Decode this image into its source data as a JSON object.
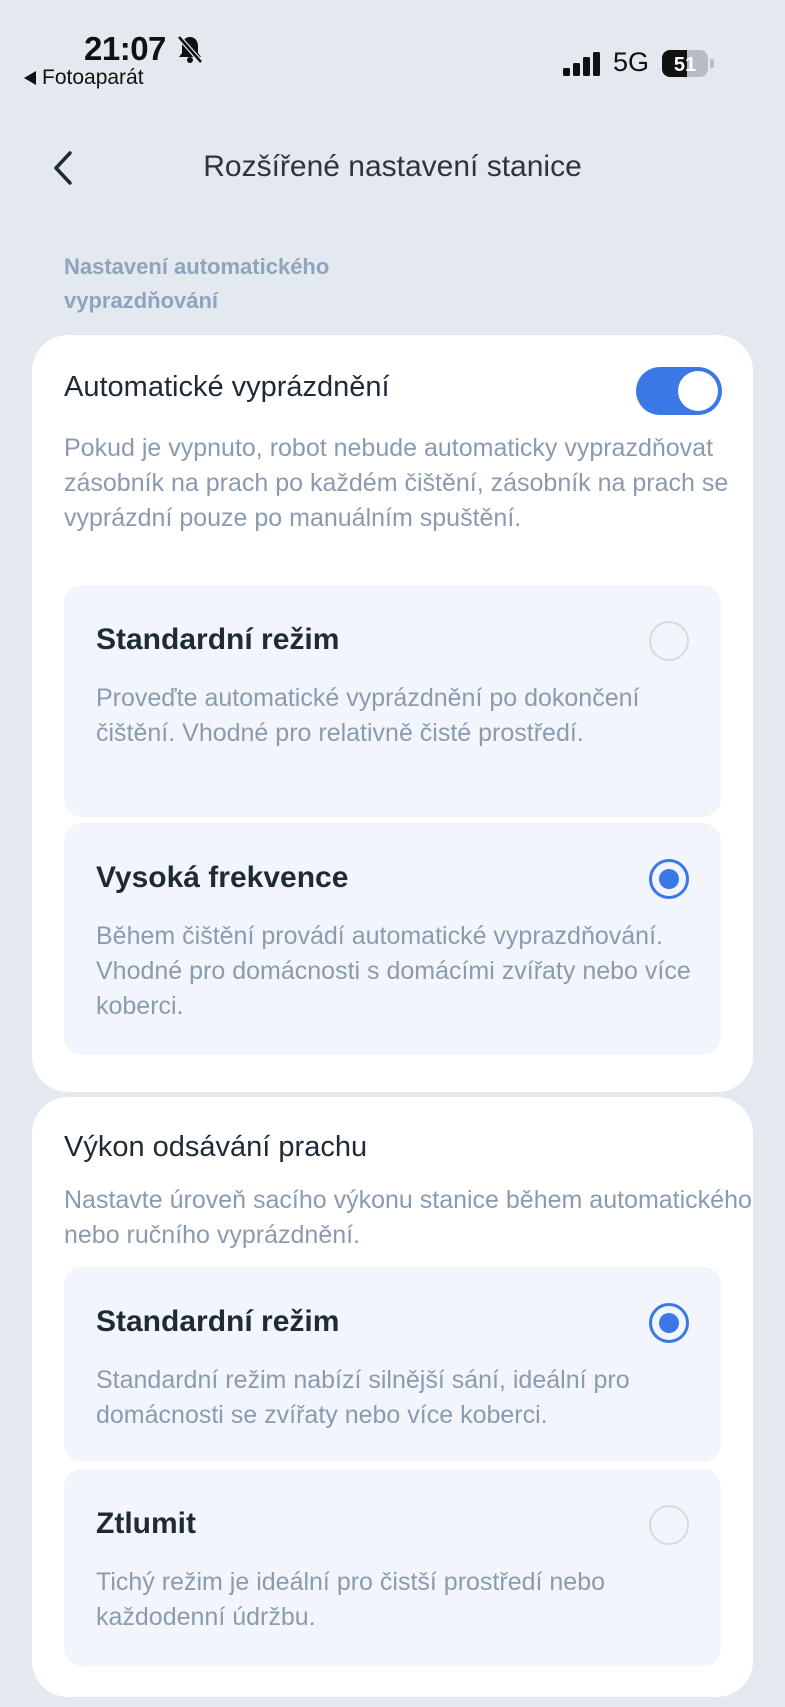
{
  "status_bar": {
    "time": "21:07",
    "back_app": "Fotoaparát",
    "network": "5G",
    "battery": "51"
  },
  "nav": {
    "title": "Rozšířené nastavení stanice"
  },
  "section": {
    "label": "Nastavení automatického vyprazdňování"
  },
  "auto_empty": {
    "title": "Automatické vyprázdnění",
    "enabled": true,
    "description": "Pokud je vypnuto, robot nebude automaticky vyprazdňovat zásobník na prach po každém čištění, zásobník na prach se vyprázdní pouze po manuálním spuštění.",
    "options": [
      {
        "title": "Standardní režim",
        "description": "Proveďte automatické vyprázdnění po dokončení čištění. Vhodné pro relativně čisté prostředí.",
        "selected": false
      },
      {
        "title": "Vysoká frekvence",
        "description": "Během čištění provádí automatické vyprazdňování. Vhodné pro domácnosti s domácími zvířaty nebo více koberci.",
        "selected": true
      }
    ]
  },
  "suction": {
    "title": "Výkon odsávání prachu",
    "description": "Nastavte úroveň sacího výkonu stanice během automatického nebo ručního vyprázdnění.",
    "options": [
      {
        "title": "Standardní režim",
        "description": "Standardní režim nabízí silnější sání, ideální pro domácnosti se zvířaty nebo více koberci.",
        "selected": true
      },
      {
        "title": "Ztlumit",
        "description": "Tichý režim je ideální pro čistší prostředí nebo každodenní údržbu.",
        "selected": false
      }
    ]
  },
  "colors": {
    "accent": "#3b78e7",
    "background": "#e4e8ef",
    "card": "#ffffff",
    "option_bg": "#f2f6fc",
    "muted_text": "#8a9bb0"
  }
}
